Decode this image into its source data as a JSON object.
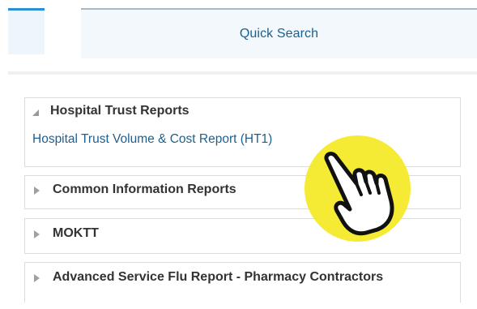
{
  "nav": {
    "quick_search_label": "Quick Search"
  },
  "reports": [
    {
      "title": "Hospital Trust Reports",
      "expanded": true,
      "links": [
        "Hospital Trust Volume & Cost Report (HT1)"
      ]
    },
    {
      "title": "Common Information Reports",
      "expanded": false
    },
    {
      "title": "MOKTT",
      "expanded": false
    },
    {
      "title": "Advanced Service Flu Report - Pharmacy Contractors",
      "expanded": false
    }
  ],
  "overlay": {
    "marker_color": "#f5e923",
    "icon": "hand-pointer-icon"
  },
  "colors": {
    "accent": "#2a8fd6",
    "link": "#1f5f8b",
    "heading": "#333333"
  }
}
